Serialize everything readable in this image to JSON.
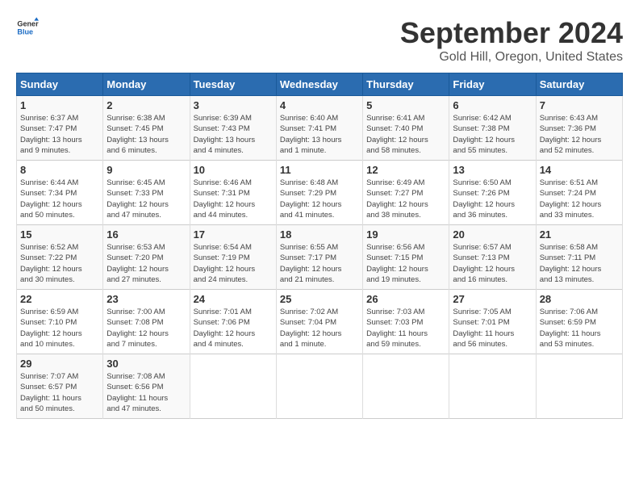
{
  "header": {
    "logo_general": "General",
    "logo_blue": "Blue",
    "month": "September 2024",
    "location": "Gold Hill, Oregon, United States"
  },
  "weekdays": [
    "Sunday",
    "Monday",
    "Tuesday",
    "Wednesday",
    "Thursday",
    "Friday",
    "Saturday"
  ],
  "weeks": [
    [
      {
        "day": "1",
        "info": "Sunrise: 6:37 AM\nSunset: 7:47 PM\nDaylight: 13 hours\nand 9 minutes."
      },
      {
        "day": "2",
        "info": "Sunrise: 6:38 AM\nSunset: 7:45 PM\nDaylight: 13 hours\nand 6 minutes."
      },
      {
        "day": "3",
        "info": "Sunrise: 6:39 AM\nSunset: 7:43 PM\nDaylight: 13 hours\nand 4 minutes."
      },
      {
        "day": "4",
        "info": "Sunrise: 6:40 AM\nSunset: 7:41 PM\nDaylight: 13 hours\nand 1 minute."
      },
      {
        "day": "5",
        "info": "Sunrise: 6:41 AM\nSunset: 7:40 PM\nDaylight: 12 hours\nand 58 minutes."
      },
      {
        "day": "6",
        "info": "Sunrise: 6:42 AM\nSunset: 7:38 PM\nDaylight: 12 hours\nand 55 minutes."
      },
      {
        "day": "7",
        "info": "Sunrise: 6:43 AM\nSunset: 7:36 PM\nDaylight: 12 hours\nand 52 minutes."
      }
    ],
    [
      {
        "day": "8",
        "info": "Sunrise: 6:44 AM\nSunset: 7:34 PM\nDaylight: 12 hours\nand 50 minutes."
      },
      {
        "day": "9",
        "info": "Sunrise: 6:45 AM\nSunset: 7:33 PM\nDaylight: 12 hours\nand 47 minutes."
      },
      {
        "day": "10",
        "info": "Sunrise: 6:46 AM\nSunset: 7:31 PM\nDaylight: 12 hours\nand 44 minutes."
      },
      {
        "day": "11",
        "info": "Sunrise: 6:48 AM\nSunset: 7:29 PM\nDaylight: 12 hours\nand 41 minutes."
      },
      {
        "day": "12",
        "info": "Sunrise: 6:49 AM\nSunset: 7:27 PM\nDaylight: 12 hours\nand 38 minutes."
      },
      {
        "day": "13",
        "info": "Sunrise: 6:50 AM\nSunset: 7:26 PM\nDaylight: 12 hours\nand 36 minutes."
      },
      {
        "day": "14",
        "info": "Sunrise: 6:51 AM\nSunset: 7:24 PM\nDaylight: 12 hours\nand 33 minutes."
      }
    ],
    [
      {
        "day": "15",
        "info": "Sunrise: 6:52 AM\nSunset: 7:22 PM\nDaylight: 12 hours\nand 30 minutes."
      },
      {
        "day": "16",
        "info": "Sunrise: 6:53 AM\nSunset: 7:20 PM\nDaylight: 12 hours\nand 27 minutes."
      },
      {
        "day": "17",
        "info": "Sunrise: 6:54 AM\nSunset: 7:19 PM\nDaylight: 12 hours\nand 24 minutes."
      },
      {
        "day": "18",
        "info": "Sunrise: 6:55 AM\nSunset: 7:17 PM\nDaylight: 12 hours\nand 21 minutes."
      },
      {
        "day": "19",
        "info": "Sunrise: 6:56 AM\nSunset: 7:15 PM\nDaylight: 12 hours\nand 19 minutes."
      },
      {
        "day": "20",
        "info": "Sunrise: 6:57 AM\nSunset: 7:13 PM\nDaylight: 12 hours\nand 16 minutes."
      },
      {
        "day": "21",
        "info": "Sunrise: 6:58 AM\nSunset: 7:11 PM\nDaylight: 12 hours\nand 13 minutes."
      }
    ],
    [
      {
        "day": "22",
        "info": "Sunrise: 6:59 AM\nSunset: 7:10 PM\nDaylight: 12 hours\nand 10 minutes."
      },
      {
        "day": "23",
        "info": "Sunrise: 7:00 AM\nSunset: 7:08 PM\nDaylight: 12 hours\nand 7 minutes."
      },
      {
        "day": "24",
        "info": "Sunrise: 7:01 AM\nSunset: 7:06 PM\nDaylight: 12 hours\nand 4 minutes."
      },
      {
        "day": "25",
        "info": "Sunrise: 7:02 AM\nSunset: 7:04 PM\nDaylight: 12 hours\nand 1 minute."
      },
      {
        "day": "26",
        "info": "Sunrise: 7:03 AM\nSunset: 7:03 PM\nDaylight: 11 hours\nand 59 minutes."
      },
      {
        "day": "27",
        "info": "Sunrise: 7:05 AM\nSunset: 7:01 PM\nDaylight: 11 hours\nand 56 minutes."
      },
      {
        "day": "28",
        "info": "Sunrise: 7:06 AM\nSunset: 6:59 PM\nDaylight: 11 hours\nand 53 minutes."
      }
    ],
    [
      {
        "day": "29",
        "info": "Sunrise: 7:07 AM\nSunset: 6:57 PM\nDaylight: 11 hours\nand 50 minutes."
      },
      {
        "day": "30",
        "info": "Sunrise: 7:08 AM\nSunset: 6:56 PM\nDaylight: 11 hours\nand 47 minutes."
      },
      {
        "day": "",
        "info": ""
      },
      {
        "day": "",
        "info": ""
      },
      {
        "day": "",
        "info": ""
      },
      {
        "day": "",
        "info": ""
      },
      {
        "day": "",
        "info": ""
      }
    ]
  ]
}
